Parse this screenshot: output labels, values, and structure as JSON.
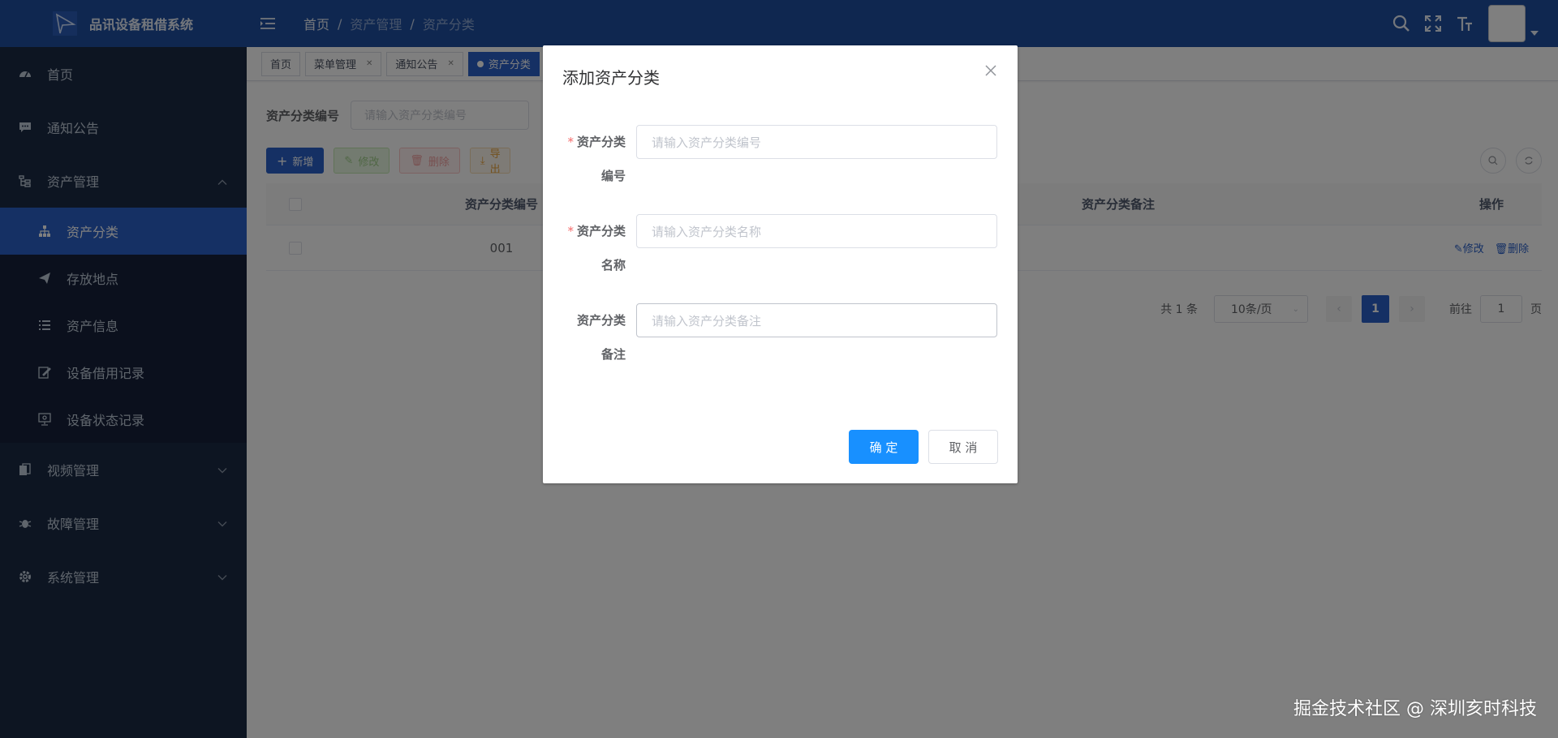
{
  "app": {
    "title": "品讯设备租借系统"
  },
  "header": {
    "breadcrumb": [
      "首页",
      "资产管理",
      "资产分类"
    ],
    "breadcrumb_sep": "/"
  },
  "sidebar": {
    "items": [
      {
        "label": "首页",
        "icon": "dashboard-icon"
      },
      {
        "label": "通知公告",
        "icon": "message-icon"
      },
      {
        "label": "资产管理",
        "icon": "tree-icon",
        "expanded": true,
        "children": [
          {
            "label": "资产分类",
            "icon": "org-icon",
            "active": true
          },
          {
            "label": "存放地点",
            "icon": "send-icon"
          },
          {
            "label": "资产信息",
            "icon": "list-icon"
          },
          {
            "label": "设备借用记录",
            "icon": "edit-icon"
          },
          {
            "label": "设备状态记录",
            "icon": "monitor-icon"
          }
        ]
      },
      {
        "label": "视频管理",
        "icon": "copy-icon"
      },
      {
        "label": "故障管理",
        "icon": "bug-icon"
      },
      {
        "label": "系统管理",
        "icon": "gear-icon"
      }
    ]
  },
  "tags": [
    {
      "label": "首页",
      "closable": false
    },
    {
      "label": "菜单管理",
      "closable": true
    },
    {
      "label": "通知公告",
      "closable": true
    },
    {
      "label": "资产分类",
      "active": true
    }
  ],
  "search": {
    "label": "资产分类编号",
    "placeholder": "请输入资产分类编号"
  },
  "toolbar": {
    "add": "新增",
    "edit": "修改",
    "delete": "删除",
    "export": "导出"
  },
  "table": {
    "headers": [
      "资产分类编号",
      "资产分类备注",
      "操作"
    ],
    "rows": [
      {
        "code": "001",
        "edit": "修改",
        "delete": "删除"
      }
    ]
  },
  "pagination": {
    "total": "共 1 条",
    "page_size": "10条/页",
    "current": "1",
    "goto_prefix": "前往",
    "goto_value": "1",
    "goto_suffix": "页"
  },
  "dialog": {
    "title": "添加资产分类",
    "fields": [
      {
        "label_line1": "资产分类",
        "label_line2": "编号",
        "required": "*",
        "placeholder": "请输入资产分类编号"
      },
      {
        "label_line1": "资产分类",
        "label_line2": "名称",
        "required": "*",
        "placeholder": "请输入资产分类名称"
      },
      {
        "label_line1": "资产分类",
        "label_line2": "备注",
        "required": "",
        "placeholder": "请输入资产分类备注"
      }
    ],
    "confirm": "确 定",
    "cancel": "取 消"
  },
  "watermark": "掘金技术社区 @ 深圳亥时科技",
  "colors": {
    "header": "#1f4fa0",
    "sidebar": "#1b2a44",
    "active": "#2a60c8",
    "primary_button": "#1890ff"
  }
}
